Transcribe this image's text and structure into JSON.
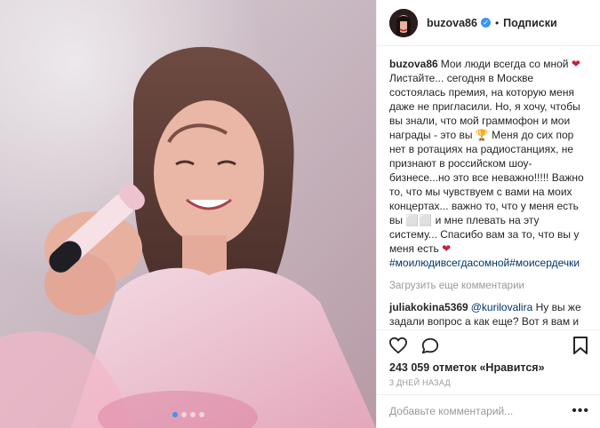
{
  "header": {
    "username": "buzova86",
    "verified_mark": "✓",
    "separator": "•",
    "follow_label": "Подписки"
  },
  "caption": {
    "username": "buzova86",
    "text": "Мои люди всегда со мной ",
    "heart": "❤",
    "text2": " Листайте... сегодня в Москве состоялась премия, на которую меня даже не пригласили. Но, я хочу, чтобы вы знали, что мой граммофон и мои награды - это вы ",
    "trophy": "🏆",
    "text3": " Меня до сих пор нет в ротациях на радиостанциях, не признают в российском шоу-бизнесе...но это все неважно!!!!! Важно то, что мы чувствуем с вами на моих концертах... важно то, что у меня есть вы ",
    "emoji_boxes": "⬜⬜",
    "text4": " и мне плевать на эту систему... Спасибо вам за то, что вы у меня есть ",
    "heart2": "❤",
    "hashtags": "#моилюдивсегдасомной#моисердечки"
  },
  "load_more": "Загрузить еще комментарии",
  "comment": {
    "username": "juliakokina5369",
    "mention": "@kurilovalira",
    "text": " Ну вы же задали вопрос а как еще? Вот я вам и ответила. Не подписаны, но заходите, проходите мимо, берегите свои нервы, она же вам не интересна"
  },
  "likes": {
    "text": "243 059 отметок «Нравится»"
  },
  "time": "3 дней назад",
  "add_comment": {
    "placeholder": "Добавьте комментарий...",
    "more": "•••"
  },
  "carousel": {
    "count": 4,
    "active_index": 0
  },
  "icons": [
    "heart-icon",
    "comment-icon",
    "bookmark-icon",
    "verified-icon"
  ],
  "colors": {
    "accent": "#3897f0",
    "hashtag": "#003569",
    "muted": "#999999",
    "text": "#262626"
  }
}
